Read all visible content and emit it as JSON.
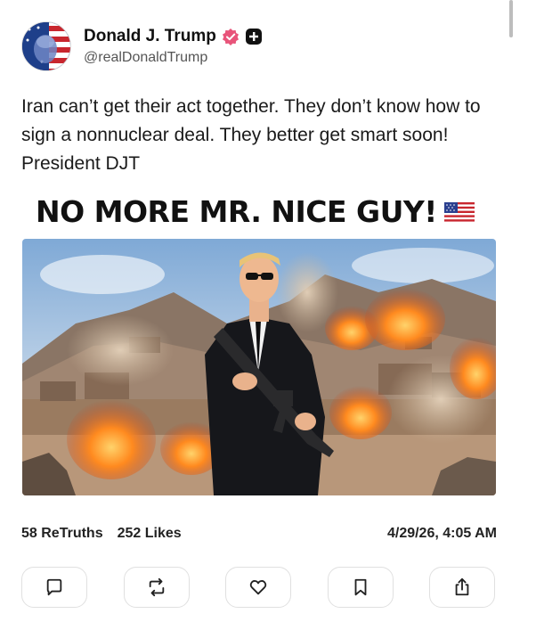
{
  "profile": {
    "display_name": "Donald J. Trump",
    "handle": "@realDonaldTrump",
    "verified_icon": "verified-badge-icon",
    "plus_icon": "plus-badge-icon"
  },
  "post": {
    "text": "Iran can’t get their act together. They don’t know how to sign a nonnuclear deal. They better get smart soon! President DJT",
    "image_caption": "NO MORE MR. NICE GUY!",
    "caption_icon": "us-flag-icon"
  },
  "stats": {
    "retruths": "58 ReTruths",
    "likes": "252 Likes",
    "timestamp": "4/29/26, 4:05 AM"
  },
  "actions": [
    {
      "name": "reply",
      "icon": "comment-icon"
    },
    {
      "name": "retruth",
      "icon": "repost-icon"
    },
    {
      "name": "like",
      "icon": "heart-icon"
    },
    {
      "name": "bookmark",
      "icon": "bookmark-icon"
    },
    {
      "name": "share",
      "icon": "share-icon"
    }
  ],
  "colors": {
    "verified": "#e8547a",
    "accent": "#111111"
  }
}
